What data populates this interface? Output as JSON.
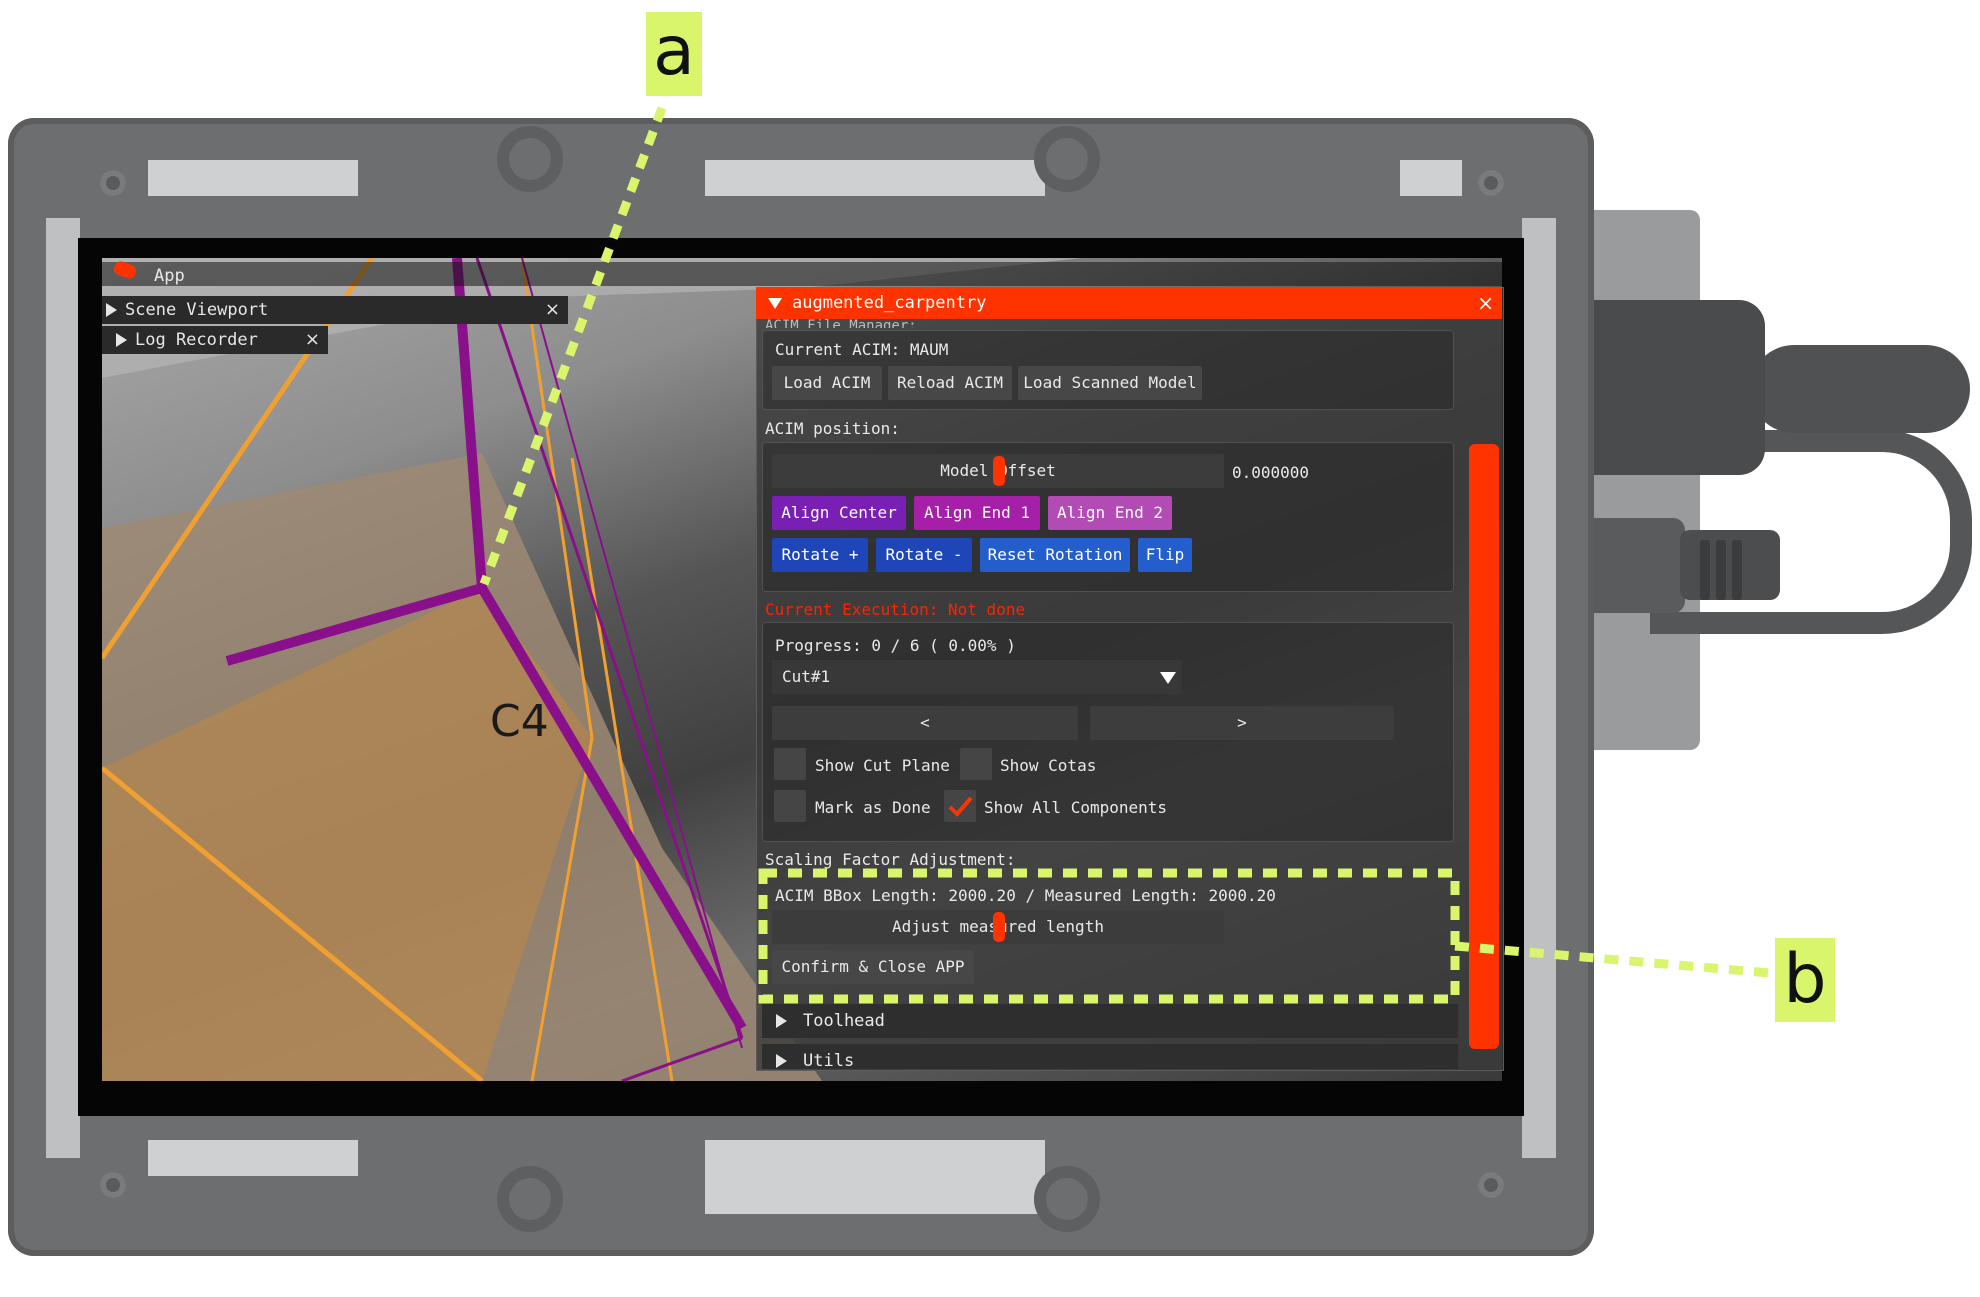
{
  "annotations": {
    "a": "a",
    "b": "b"
  },
  "overlay": {
    "label_c4": "C4"
  },
  "menubar": {
    "app_label": "App"
  },
  "side_windows": [
    {
      "title": "Scene Viewport",
      "close": "×"
    },
    {
      "title": "Log Recorder",
      "close": "×"
    }
  ],
  "main_window": {
    "title": "augmented_carpentry",
    "close": "×",
    "file_manager": {
      "header": "ACIM File Manager:",
      "current_acim": "Current ACIM:  MAUM",
      "load_acim": "Load ACIM",
      "reload_acim": "Reload ACIM",
      "load_scanned": "Load Scanned Model"
    },
    "position": {
      "header": "ACIM position:",
      "model_offset": "Model Offset",
      "offset_value": "0.000000",
      "align_center": "Align Center",
      "align_end1": "Align End 1",
      "align_end2": "Align End 2",
      "rotate_plus": "Rotate +",
      "rotate_minus": "Rotate -",
      "reset_rotation": "Reset Rotation",
      "flip": "Flip"
    },
    "execution": {
      "status": "Current Execution: Not done",
      "progress": "Progress: 0 / 6 ( 0.00% )",
      "combo_value": "Cut#1",
      "prev": "<",
      "next": ">",
      "show_cut_plane": "Show Cut Plane",
      "show_cotas": "Show Cotas",
      "mark_as_done": "Mark as Done",
      "show_all_components": "Show All Components",
      "show_all_checked": true
    },
    "scaling": {
      "header": "Scaling Factor Adjustment:",
      "lengths": "ACIM BBox Length: 2000.20 / Measured Length: 2000.20",
      "adjust": "Adjust measured length",
      "confirm": "Confirm & Close APP"
    },
    "sections": {
      "toolhead": "Toolhead",
      "utils": "Utils"
    }
  },
  "colors": {
    "accent": "#ff3300",
    "annotation": "#d9f56b",
    "cut_purple": "#8a0f8a",
    "cut_orange": "#f0a030"
  },
  "icons": {
    "app": "app-logo-icon",
    "check": "checkmark-icon"
  }
}
